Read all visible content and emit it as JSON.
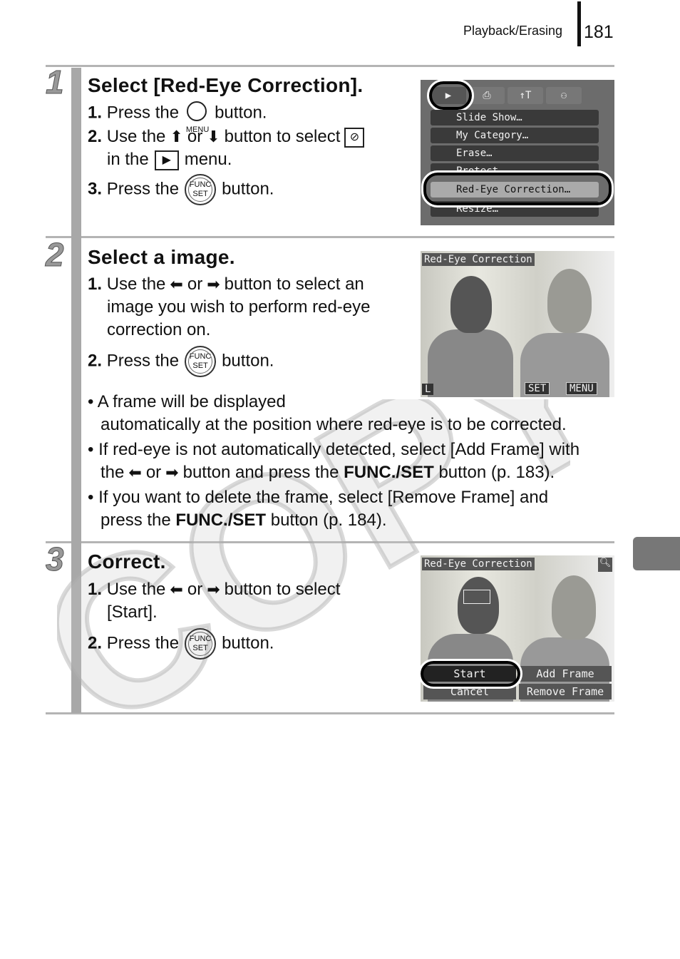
{
  "header": {
    "section": "Playback/Erasing",
    "page": "181"
  },
  "watermark": "COPY",
  "steps": [
    {
      "num": "1",
      "title": "Select [Red-Eye Correction].",
      "l1": {
        "n": "1.",
        "a": "Press the",
        "icon": "MENU",
        "b": "button."
      },
      "l2": {
        "n": "2.",
        "a": "Use the",
        "or": "or",
        "b": "button to select",
        "c": "in the",
        "d": "menu."
      },
      "l3": {
        "n": "3.",
        "a": "Press the",
        "icon": "FUNC SET",
        "b": "button."
      },
      "screen": {
        "tabs": [
          "▶",
          "⎙",
          "↑T",
          "⚇"
        ],
        "items": [
          "Slide Show…",
          "My Category…",
          "Erase…",
          "Protect…",
          "Red-Eye Correction…",
          "Resize…"
        ]
      }
    },
    {
      "num": "2",
      "title": "Select a image.",
      "l1": {
        "n": "1.",
        "a": "Use the",
        "or": "or",
        "b": "button to select an",
        "c": "image you wish to perform red-eye",
        "d": "correction on."
      },
      "l2": {
        "n": "2.",
        "a": "Press the",
        "icon": "FUNC SET",
        "b": "button."
      },
      "bullets": [
        {
          "a": "A frame will be displayed",
          "b": "automatically at the position where red-eye is to be corrected."
        },
        {
          "a": "If red-eye is not automatically detected, select [Add Frame] with",
          "b": "the",
          "or": "or",
          "c": "button and press the",
          "bold": "FUNC./SET",
          "d": "button (p. 183)."
        },
        {
          "a": "If you want to delete the frame, select [Remove Frame] and",
          "b": "press the",
          "bold": "FUNC./SET",
          "c": "button (p. 184)."
        }
      ],
      "screen": {
        "title": "Red-Eye Correction",
        "size": "L",
        "set": "SET",
        "menu": "MENU"
      }
    },
    {
      "num": "3",
      "title": "Correct.",
      "l1": {
        "n": "1.",
        "a": "Use the",
        "or": "or",
        "b": "button to select",
        "c": "[Start]."
      },
      "l2": {
        "n": "2.",
        "a": "Press the",
        "icon": "FUNC SET",
        "b": "button."
      },
      "screen": {
        "title": "Red-Eye Correction",
        "buttons": [
          "Start",
          "Add Frame",
          "Cancel",
          "Remove Frame"
        ]
      }
    }
  ]
}
